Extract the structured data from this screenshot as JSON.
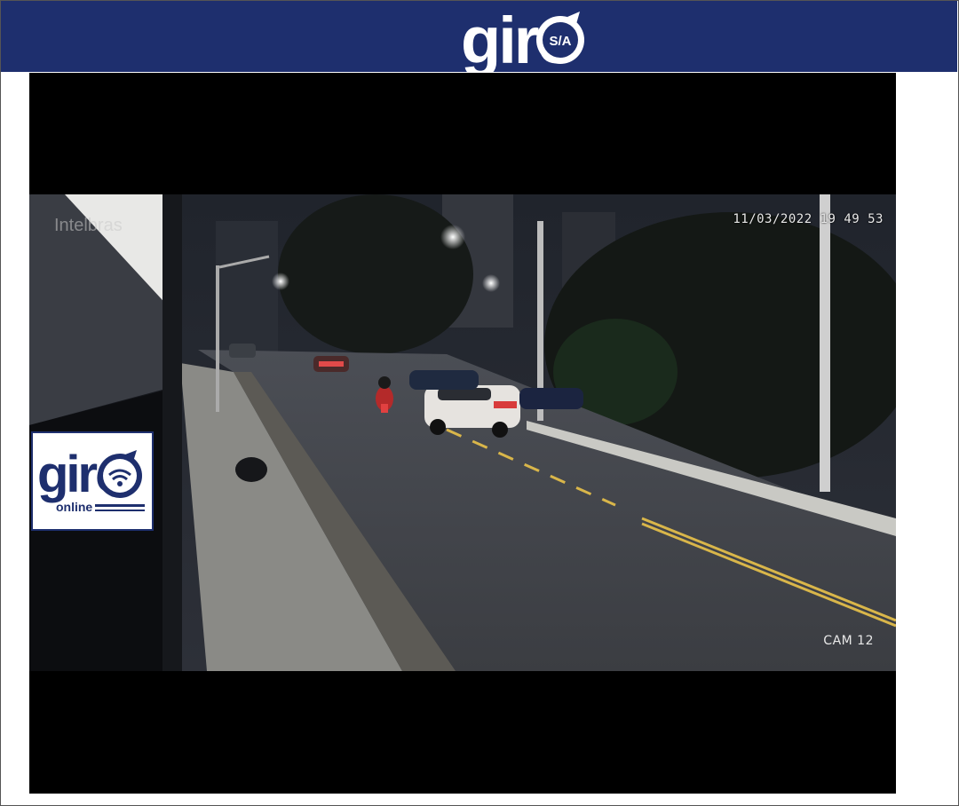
{
  "header": {
    "logo_text": "giro",
    "logo_badge": "S/A",
    "brand_color": "#1e2f6e"
  },
  "video": {
    "timestamp": "11/03/2022 19 49 53",
    "camera_label": "CAM 12",
    "source_watermark": "Intelbras"
  },
  "overlay_logo": {
    "logo_text": "giro",
    "sub_text": "online",
    "icon": "wifi-icon"
  }
}
